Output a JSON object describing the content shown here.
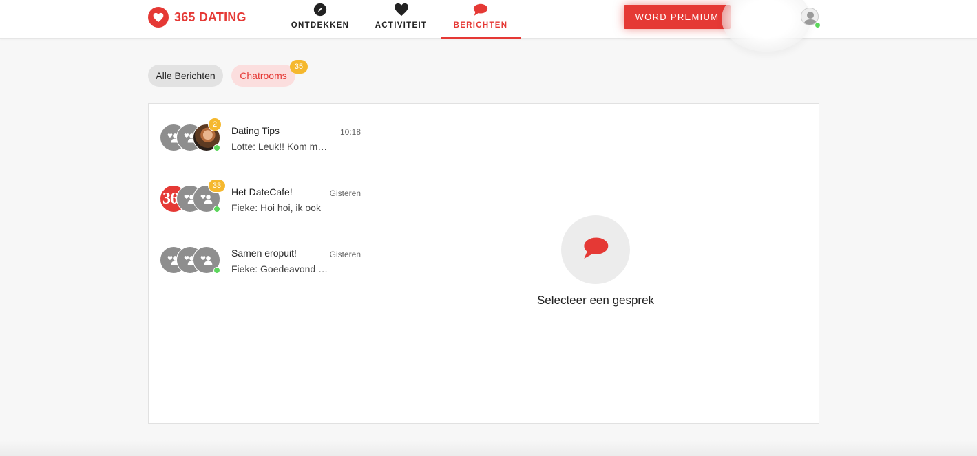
{
  "header": {
    "logo_text": "365 DATING",
    "logo_icon": "heart-icon",
    "nav": [
      {
        "label": "ONTDEKKEN",
        "icon": "compass-icon"
      },
      {
        "label": "ACTIVITEIT",
        "icon": "heart-icon"
      },
      {
        "label": "BERICHTEN",
        "icon": "chat-bubble-icon",
        "active": true
      }
    ],
    "premium_label": "WORD PREMIUM"
  },
  "filters": {
    "all_label": "Alle Berichten",
    "rooms_label": "Chatrooms",
    "rooms_count": "35"
  },
  "conversations": [
    {
      "title": "Dating Tips",
      "preview": "Lotte: Leuk!! Kom maar",
      "time": "10:18",
      "unread": "2"
    },
    {
      "title": "Het DateCafe!",
      "preview": "Fieke: Hoi hoi, ik ook",
      "time": "Gisteren",
      "unread": "33",
      "brand_text": "365"
    },
    {
      "title": "Samen eropuit!",
      "preview": "Fieke: Goedeavond allemaal",
      "time": "Gisteren"
    }
  ],
  "empty_state": {
    "text": "Selecteer een gesprek",
    "icon": "chat-bubble-icon"
  },
  "colors": {
    "accent": "#e53935",
    "badge": "#f5b82e",
    "online": "#5cd65c"
  }
}
